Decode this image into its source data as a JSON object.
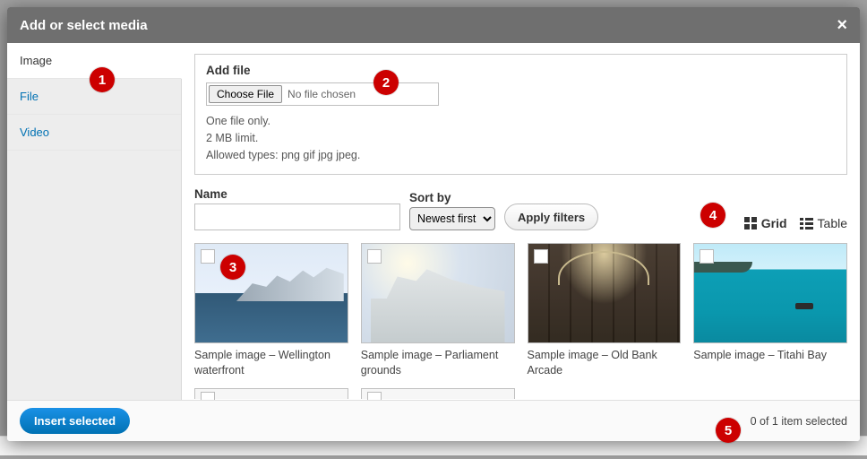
{
  "dialog": {
    "title": "Add or select media",
    "close_glyph": "×"
  },
  "sidebar": {
    "tabs": [
      {
        "label": "Image",
        "active": true
      },
      {
        "label": "File",
        "active": false
      },
      {
        "label": "Video",
        "active": false
      }
    ]
  },
  "upload": {
    "heading": "Add file",
    "choose_label": "Choose File",
    "no_file_text": "No file chosen",
    "hint1": "One file only.",
    "hint2": "2 MB limit.",
    "hint3": "Allowed types: png gif jpg jpeg."
  },
  "filters": {
    "name_label": "Name",
    "name_value": "",
    "sort_label": "Sort by",
    "sort_selected": "Newest first",
    "apply_label": "Apply filters"
  },
  "view": {
    "grid_label": "Grid",
    "table_label": "Table"
  },
  "tiles": [
    {
      "caption": "Sample image – Wellington waterfront",
      "art": "art-wellington"
    },
    {
      "caption": "Sample image – Parliament grounds",
      "art": "art-parliament"
    },
    {
      "caption": "Sample image – Old Bank Arcade",
      "art": "art-arcade"
    },
    {
      "caption": "Sample image – Titahi Bay",
      "art": "art-titahi"
    }
  ],
  "footer": {
    "insert_label": "Insert selected",
    "status": "0 of 1 item selected"
  },
  "annotations": {
    "n1": "1",
    "n2": "2",
    "n3": "3",
    "n4": "4",
    "n5": "5"
  }
}
